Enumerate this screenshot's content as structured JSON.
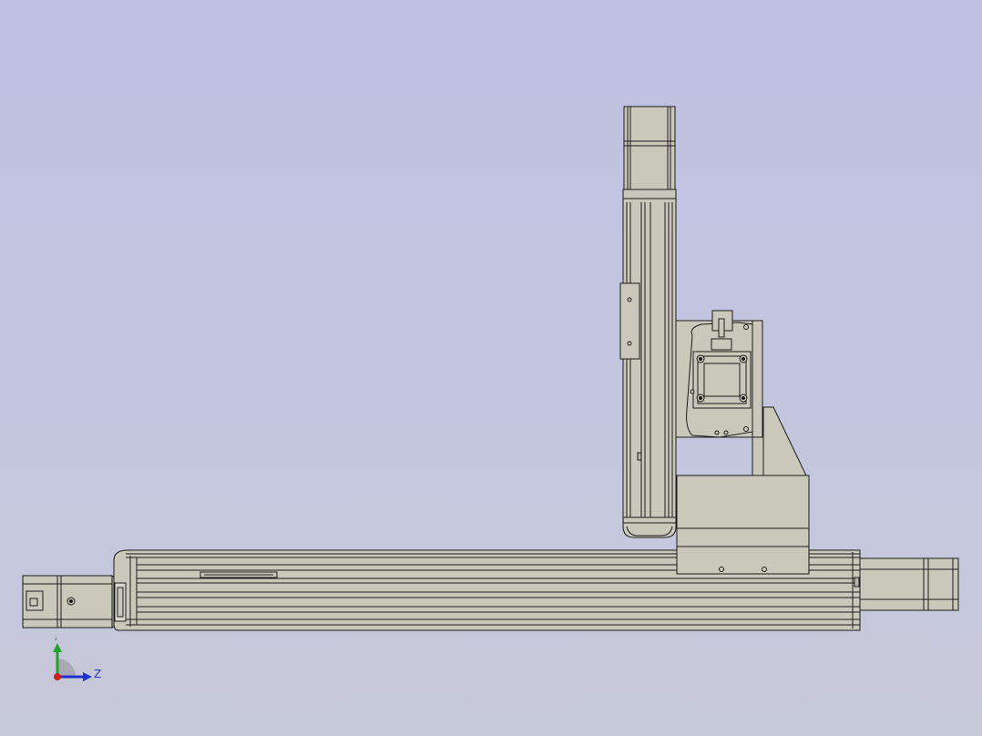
{
  "viewport": {
    "background_top": "#bfc0e1",
    "background_bottom": "#c6c9d8"
  },
  "model": {
    "part_fill": "#c9c8ba",
    "part_fill_dark": "#a9a89a",
    "edge_color": "#1a1a1a",
    "assemblies": [
      "horizontal-linear-module",
      "horizontal-drive-motor",
      "vertical-linear-module",
      "vertical-drive-motor",
      "z-carriage-bracket",
      "left-end-cap-sensor"
    ]
  },
  "triad": {
    "y_label": "Y",
    "z_label": "Z",
    "y_color": "#1fa32a",
    "z_color": "#1f2fd0",
    "origin_color": "#d01f1f"
  }
}
